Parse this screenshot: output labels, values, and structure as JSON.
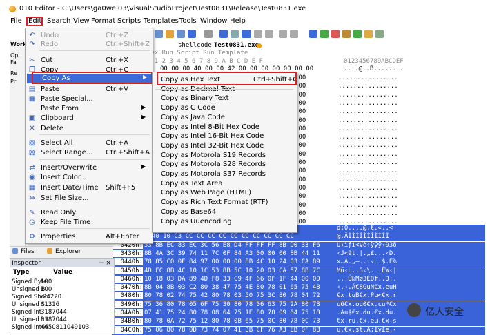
{
  "window": {
    "title": "010 Editor - C:\\Users\\ga0wel03\\VisualStudioProject\\Test0831\\Release\\Test0831.exe"
  },
  "menubar": [
    "File",
    "Edit",
    "Search",
    "View",
    "Format",
    "Scripts",
    "Templates",
    "Tools",
    "Window",
    "Help"
  ],
  "left_panel": {
    "tab": "Works",
    "items": [
      "Op",
      "Fa",
      "Re",
      "Pc"
    ]
  },
  "editor": {
    "tabs": [
      "shellcode",
      "Test0831.exe"
    ],
    "header": "Hex  Run Script  Run Template",
    "columns": "0  1  2  3  4  5  6  7  8  9  A  B  C  D  E  F",
    "ascii_header": "0123456789ABCDEF",
    "first_row": "00 00 00 40 00 00 42 00 00 00 00 00 00 00",
    "first_row_ascii": "....@..B........",
    "side_rows": [
      {
        "hex": "00 00 00",
        "ascii": "................"
      },
      {
        "hex": "00 00 00",
        "ascii": "................"
      },
      {
        "hex": "00 00 00",
        "ascii": "................"
      },
      {
        "hex": "00 00 00",
        "ascii": "................"
      },
      {
        "hex": "00 00 00",
        "ascii": "................"
      },
      {
        "hex": "00 00 00",
        "ascii": "................"
      },
      {
        "hex": "00 00 00",
        "ascii": "................"
      },
      {
        "hex": "00 00 00",
        "ascii": "................"
      },
      {
        "hex": "00 00 00",
        "ascii": "................"
      },
      {
        "hex": "00 00 00",
        "ascii": "................"
      },
      {
        "hex": "00 00 00",
        "ascii": "................"
      },
      {
        "hex": "00 00 00",
        "ascii": "................"
      },
      {
        "hex": "00 00 00",
        "ascii": "................"
      },
      {
        "hex": "00 00 00",
        "ascii": "................"
      },
      {
        "hex": "00 00 00",
        "ascii": "................"
      },
      {
        "hex": "00 00 00",
        "ascii": "................"
      },
      {
        "hex": "00 00 00",
        "ascii": "................"
      },
      {
        "hex": "00 00 00",
        "ascii": "................"
      }
    ],
    "selected_rows": [
      {
        "addr": "",
        "bytes": "00 00 00 00 00 00 00 00 00 00 00 8B 00",
        "ascii": "d;0....@.€.«..<"
      },
      {
        "addr": "",
        "bytes": "8 40 10 C3 CC CC CC CC CC CC CC CC CC CC",
        "ascii": "@.ÃÌÌÌÌÌÌÌÌÌÌÌ"
      },
      {
        "addr": "0420h:",
        "bytes": "53 8B EC 83 EC 3C 56 E8 D4 FF FF FF 8B D0 33 F6",
        "ascii": "U‹ìƒì<Vè÷ÿÿÿ‹Ð3ö"
      },
      {
        "addr": "0430h:",
        "bytes": "8B 4A 3C 39 74 11 7C 0F 84 A3 00 00 00 8B 44 11",
        "ascii": "‹J<9t.|.„£...‹D."
      },
      {
        "addr": "0440h:",
        "bytes": "78 85 C0 0F 84 97 00 00 00 8B 4C 10 24 03 CA 89",
        "ascii": "x…À.„—...‹L.$.Ê‰"
      },
      {
        "addr": "0450h:",
        "bytes": "4D FC 8B 4C 10 1C 53 8B 5C 10 20 03 CA 57 8B 7C",
        "ascii": "Mü‹L..S‹\\. .ÊW‹|"
      },
      {
        "addr": "0460h:",
        "bytes": "10 18 03 DA 89 4D F8 33 C9 4F 66 0F 1F 44 00 00",
        "ascii": "...Ú‰Mø3ÉOf..D.."
      },
      {
        "addr": "0470h:",
        "bytes": "8B 04 8B 03 C2 80 38 47 75 4E 80 78 01 65 75 48",
        "ascii": "‹.‹.Â€8GuN€x.euH"
      },
      {
        "addr": "0480h:",
        "bytes": "80 78 02 74 75 42 80 78 03 50 75 3C 80 78 04 72",
        "ascii": "€x.tuB€x.Pu<€x.r"
      },
      {
        "addr": "0490h:",
        "bytes": "75 36 80 78 05 6F 75 30 80 78 06 63 75 2A 80 78",
        "ascii": "u6€x.ou0€x.cu*€x"
      },
      {
        "addr": "04A0h:",
        "bytes": "07 41 75 24 80 78 08 64 75 1E 80 78 09 64 75 18",
        "ascii": ".Au$€x.du.€x.du."
      },
      {
        "addr": "04B0h:",
        "bytes": "80 78 0A 72 75 12 80 78 0B 65 75 0C 80 78 0C 73",
        "ascii": "€x.ru.€x.eu.€x.s"
      },
      {
        "addr": "04C0h:",
        "bytes": "75 06 80 78 0D 73 74 07 41 3B CF 76 A3 EB 0F 8B",
        "ascii": "u.€x.st.A;Ïv£ë.‹"
      }
    ]
  },
  "edit_menu": {
    "items": [
      {
        "icon": "undo-icon",
        "label": "Undo",
        "shortcut": "Ctrl+Z",
        "disabled": true
      },
      {
        "icon": "redo-icon",
        "label": "Redo",
        "shortcut": "Ctrl+Shift+Z",
        "disabled": true
      },
      {
        "icon": "cut-icon",
        "label": "Cut",
        "shortcut": "Ctrl+X"
      },
      {
        "icon": "copy-icon",
        "label": "Copy",
        "shortcut": "Ctrl+C"
      },
      {
        "icon": "",
        "label": "Copy As",
        "shortcut": "",
        "submenu": true,
        "highlight": true
      },
      {
        "icon": "paste-icon",
        "label": "Paste",
        "shortcut": "Ctrl+V"
      },
      {
        "icon": "paste-special-icon",
        "label": "Paste Special...",
        "shortcut": ""
      },
      {
        "icon": "",
        "label": "Paste From",
        "shortcut": "",
        "submenu": true
      },
      {
        "icon": "clipboard-icon",
        "label": "Clipboard",
        "shortcut": "",
        "submenu": true
      },
      {
        "icon": "delete-icon",
        "label": "Delete",
        "shortcut": ""
      },
      {
        "icon": "select-all-icon",
        "label": "Select All",
        "shortcut": "Ctrl+A"
      },
      {
        "icon": "select-range-icon",
        "label": "Select Range...",
        "shortcut": "Ctrl+Shift+A"
      },
      {
        "icon": "insert-overwrite-icon",
        "label": "Insert/Overwrite",
        "shortcut": "",
        "submenu": true
      },
      {
        "icon": "insert-color-icon",
        "label": "Insert Color...",
        "shortcut": ""
      },
      {
        "icon": "calendar-icon",
        "label": "Insert Date/Time",
        "shortcut": "Shift+F5"
      },
      {
        "icon": "file-size-icon",
        "label": "Set File Size...",
        "shortcut": ""
      },
      {
        "icon": "read-only-icon",
        "label": "Read Only",
        "shortcut": ""
      },
      {
        "icon": "clock-icon",
        "label": "Keep File Time",
        "shortcut": ""
      },
      {
        "icon": "properties-icon",
        "label": "Properties",
        "shortcut": "Alt+Enter"
      }
    ]
  },
  "copy_as_submenu": [
    {
      "label": "Copy as Hex Text",
      "shortcut": "Ctrl+Shift+C"
    },
    {
      "label": "Copy as Decimal Text"
    },
    {
      "label": "Copy as Binary Text"
    },
    {
      "label": "Copy as C Code"
    },
    {
      "label": "Copy as Java Code"
    },
    {
      "label": "Copy as Intel 8-Bit Hex Code"
    },
    {
      "label": "Copy as Intel 16-Bit Hex Code"
    },
    {
      "label": "Copy as Intel 32-Bit Hex Code"
    },
    {
      "label": "Copy as Motorola S19 Records"
    },
    {
      "label": "Copy as Motorola S28 Records"
    },
    {
      "label": "Copy as Motorola S37 Records"
    },
    {
      "label": "Copy as Text Area"
    },
    {
      "label": "Copy as Web Page (HTML)"
    },
    {
      "label": "Copy as Rich Text Format (RTF)"
    },
    {
      "label": "Copy as Base64"
    },
    {
      "label": "Copy as Uuencoding"
    }
  ],
  "bottom_tabs": [
    "Files",
    "Explorer"
  ],
  "inspector": {
    "title": "Inspector",
    "pin": "− ×",
    "col_type": "Type",
    "col_value": "Value",
    "rows": [
      {
        "type": "Signed Byte",
        "value": "100"
      },
      {
        "type": "Unsigned B...",
        "value": "100"
      },
      {
        "type": "Signed Short",
        "value": "-24220"
      },
      {
        "type": "Unsigned S...",
        "value": "41316"
      },
      {
        "type": "Signed Int",
        "value": "3187044"
      },
      {
        "type": "Unsigned Int",
        "value": "3187044"
      },
      {
        "type": "Signed Int64",
        "value": "4650811049103"
      }
    ]
  },
  "watermark": {
    "text": "亿人安全"
  },
  "colors": {
    "highlight": "#3c6ad8",
    "selection": "#3b63d9",
    "annotation": "#e0201f"
  }
}
